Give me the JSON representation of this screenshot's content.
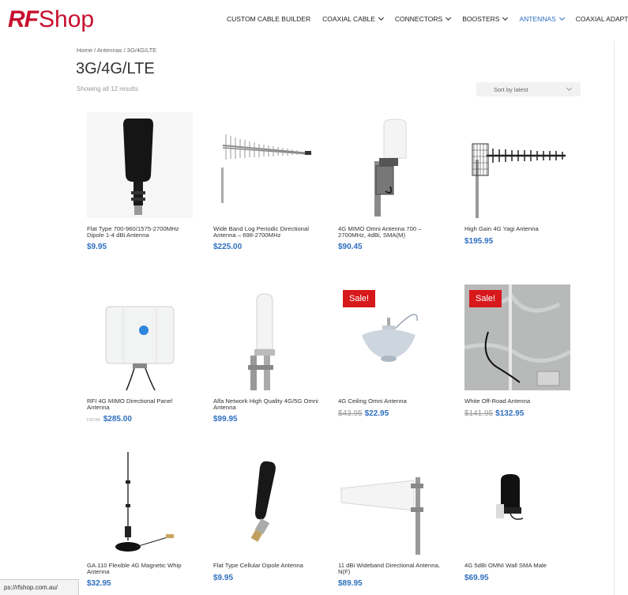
{
  "brand": {
    "logo_rf": "RF",
    "logo_shop": "Shop",
    "color": "#c8102e"
  },
  "nav": [
    {
      "label": "CUSTOM CABLE BUILDER",
      "dropdown": false,
      "active": false
    },
    {
      "label": "COAXIAL CABLE",
      "dropdown": true,
      "active": false
    },
    {
      "label": "CONNECTORS",
      "dropdown": true,
      "active": false
    },
    {
      "label": "BOOSTERS",
      "dropdown": true,
      "active": false
    },
    {
      "label": "ANTENNAS",
      "dropdown": true,
      "active": true
    },
    {
      "label": "COAXIAL ADAPTERS",
      "dropdown": false,
      "active": false
    }
  ],
  "breadcrumb": "Home / Antennas / 3G/4G/LTE",
  "page_title": "3G/4G/LTE",
  "result_count": "Showing all 12 results",
  "sort": {
    "selected": "Sort by latest"
  },
  "accent": "#2e6fbf",
  "sale_badge": "Sale!",
  "products": [
    {
      "title": "Flat Type 700-960/1575-2700MHz Dipole 1-4 dBi Antenna",
      "price": "$9.95",
      "image": "flat-dipole-black"
    },
    {
      "title": "Wide Band Log Periodic Directional Antenna – 698-2700MHz",
      "price": "$225.00",
      "image": "log-periodic"
    },
    {
      "title": "4G MIMO Omni Antenna 700 – 2700MHz, 4dBi, SMA(M)",
      "price": "$90.45",
      "image": "omni-white-mast"
    },
    {
      "title": "High Gain 4G Yagi Antenna",
      "price": "$195.95",
      "image": "yagi"
    },
    {
      "title": "RFI 4G MIMO Directional Panel Antenna",
      "from_label": "FROM:",
      "price": "$285.00",
      "image": "panel-white"
    },
    {
      "title": "Alfa Network High Quality 4G/5G Omni Antenna",
      "price": "$99.95",
      "image": "omni-tall-white"
    },
    {
      "title": "4G Ceiling Omni Antenna",
      "old_price": "$43.95",
      "price": "$22.95",
      "sale": true,
      "image": "ceiling-dome"
    },
    {
      "title": "White Off-Road Antenna",
      "old_price": "$141.95",
      "price": "$132.95",
      "sale": true,
      "image": "offroad-whip"
    },
    {
      "title": "GA.110 Flexible 4G Magnetic Whip Antenna",
      "price": "$32.95",
      "image": "magnetic-whip"
    },
    {
      "title": "Flat Type Cellular Dipole Antenna",
      "price": "$9.95",
      "image": "cellular-dipole"
    },
    {
      "title": "11 dBi Wideband Directional Antenna, N(F)",
      "price": "$89.95",
      "image": "wideband-directional"
    },
    {
      "title": "4G 5dBi OMNI Wall SMA Male",
      "price": "$69.95",
      "image": "wall-omni"
    }
  ],
  "status_url": "ps://rfshop.com.au/"
}
